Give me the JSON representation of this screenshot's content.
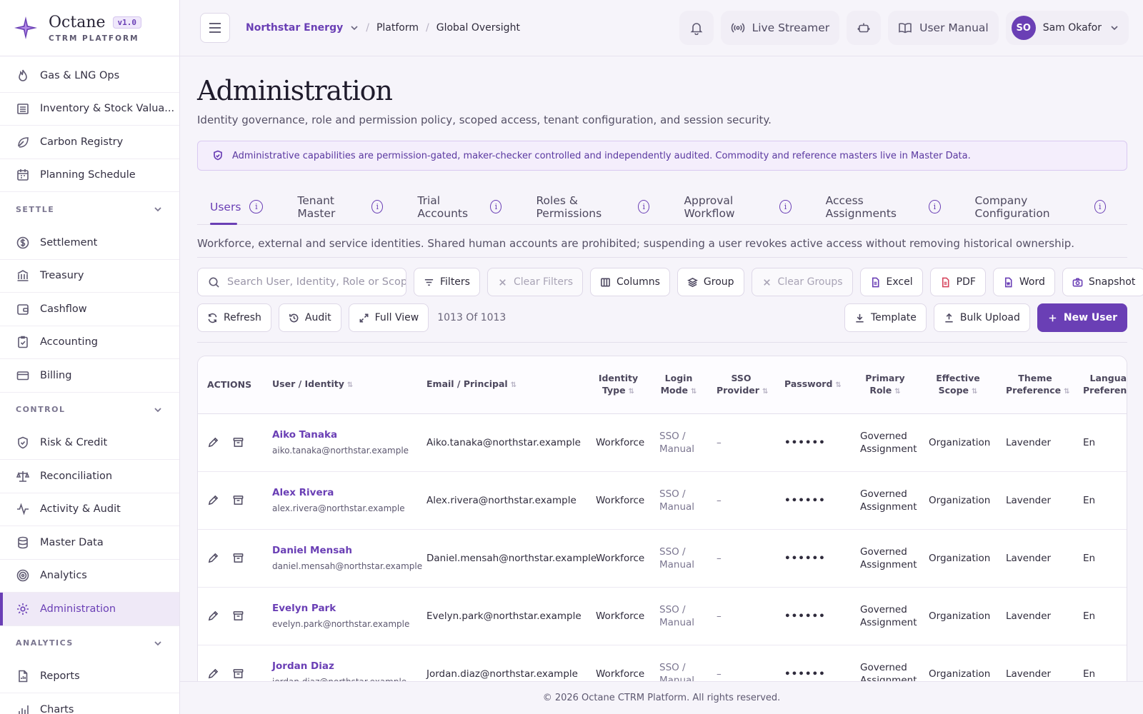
{
  "brand": {
    "name": "Octane",
    "version": "v1.0",
    "subtitle": "CTRM PLATFORM",
    "accent": "#6a3fb5"
  },
  "sidebar": {
    "items_top": [
      {
        "label": "Gas & LNG Ops",
        "icon": "flame-icon"
      },
      {
        "label": "Inventory & Stock Valua...",
        "icon": "warehouse-icon"
      },
      {
        "label": "Carbon Registry",
        "icon": "leaf-icon"
      },
      {
        "label": "Planning Schedule",
        "icon": "calendar-icon"
      }
    ],
    "group_settle": "SETTLE",
    "items_settle": [
      {
        "label": "Settlement",
        "icon": "dollar-circle-icon"
      },
      {
        "label": "Treasury",
        "icon": "bank-icon"
      },
      {
        "label": "Cashflow",
        "icon": "wallet-icon"
      },
      {
        "label": "Accounting",
        "icon": "clipboard-check-icon"
      },
      {
        "label": "Billing",
        "icon": "credit-card-icon"
      }
    ],
    "group_control": "CONTROL",
    "items_control": [
      {
        "label": "Risk & Credit",
        "icon": "shield-check-icon"
      },
      {
        "label": "Reconciliation",
        "icon": "scale-icon"
      },
      {
        "label": "Activity & Audit",
        "icon": "activity-icon"
      },
      {
        "label": "Master Data",
        "icon": "database-icon"
      },
      {
        "label": "Analytics",
        "icon": "target-icon"
      },
      {
        "label": "Administration",
        "icon": "gear-icon",
        "active": true
      }
    ],
    "group_analytics": "ANALYTICS",
    "items_analytics": [
      {
        "label": "Reports",
        "icon": "document-chart-icon"
      },
      {
        "label": "Charts",
        "icon": "bar-chart-icon"
      }
    ]
  },
  "topbar": {
    "tenant": "Northstar Energy",
    "crumb1": "Platform",
    "crumb2": "Global Oversight",
    "live_streamer": "Live Streamer",
    "user_manual": "User Manual",
    "user_initials": "SO",
    "user_name": "Sam Okafor"
  },
  "page": {
    "title": "Administration",
    "subtitle": "Identity governance, role and permission policy, scoped access, tenant configuration, and session security.",
    "notice": "Administrative capabilities are permission-gated, maker-checker controlled and independently audited. Commodity and reference masters live in Master Data.",
    "tabs": [
      "Users",
      "Tenant Master",
      "Trial Accounts",
      "Roles & Permissions",
      "Approval Workflow",
      "Access Assignments",
      "Company Configuration"
    ],
    "active_tab": "Users",
    "tab_description": "Workforce, external and service identities. Shared human accounts are prohibited; suspending a user revokes active access without removing historical ownership."
  },
  "toolbar": {
    "search_placeholder": "Search User, Identity, Role or Scope",
    "filters": "Filters",
    "clear_filters": "Clear Filters",
    "columns": "Columns",
    "group": "Group",
    "clear_groups": "Clear Groups",
    "excel": "Excel",
    "pdf": "PDF",
    "word": "Word",
    "snapshot": "Snapshot",
    "refresh": "Refresh",
    "audit": "Audit",
    "full_view": "Full View",
    "count": "1013 Of 1013",
    "template": "Template",
    "bulk_upload": "Bulk Upload",
    "new_user": "New User"
  },
  "table": {
    "headers": {
      "actions": "ACTIONS",
      "user": "User / Identity",
      "email": "Email / Principal",
      "identity_type": "Identity Type",
      "login_mode": "Login Mode",
      "sso_provider": "SSO Provider",
      "password": "Password",
      "primary_role": "Primary Role",
      "effective_scope": "Effective Scope",
      "theme": "Theme Preference",
      "language": "Language Preference"
    },
    "rows": [
      {
        "name": "Aiko Tanaka",
        "sub": "aiko.tanaka@northstar.example",
        "email": "Aiko.tanaka@northstar.example",
        "type": "Workforce",
        "login": "SSO / Manual",
        "sso": "–",
        "password": "••••••",
        "role": "Governed Assignment",
        "scope": "Organization",
        "theme": "Lavender",
        "lang": "En"
      },
      {
        "name": "Alex Rivera",
        "sub": "alex.rivera@northstar.example",
        "email": "Alex.rivera@northstar.example",
        "type": "Workforce",
        "login": "SSO / Manual",
        "sso": "–",
        "password": "••••••",
        "role": "Governed Assignment",
        "scope": "Organization",
        "theme": "Lavender",
        "lang": "En"
      },
      {
        "name": "Daniel Mensah",
        "sub": "daniel.mensah@northstar.example",
        "email": "Daniel.mensah@northstar.example",
        "type": "Workforce",
        "login": "SSO / Manual",
        "sso": "–",
        "password": "••••••",
        "role": "Governed Assignment",
        "scope": "Organization",
        "theme": "Lavender",
        "lang": "En"
      },
      {
        "name": "Evelyn Park",
        "sub": "evelyn.park@northstar.example",
        "email": "Evelyn.park@northstar.example",
        "type": "Workforce",
        "login": "SSO / Manual",
        "sso": "–",
        "password": "••••••",
        "role": "Governed Assignment",
        "scope": "Organization",
        "theme": "Lavender",
        "lang": "En"
      },
      {
        "name": "Jordan Diaz",
        "sub": "jordan.diaz@northstar.example",
        "email": "Jordan.diaz@northstar.example",
        "type": "Workforce",
        "login": "SSO / Manual",
        "sso": "–",
        "password": "••••••",
        "role": "Governed Assignment",
        "scope": "Organization",
        "theme": "Lavender",
        "lang": "En"
      }
    ]
  },
  "footer": "© 2026 Octane CTRM Platform. All rights reserved."
}
